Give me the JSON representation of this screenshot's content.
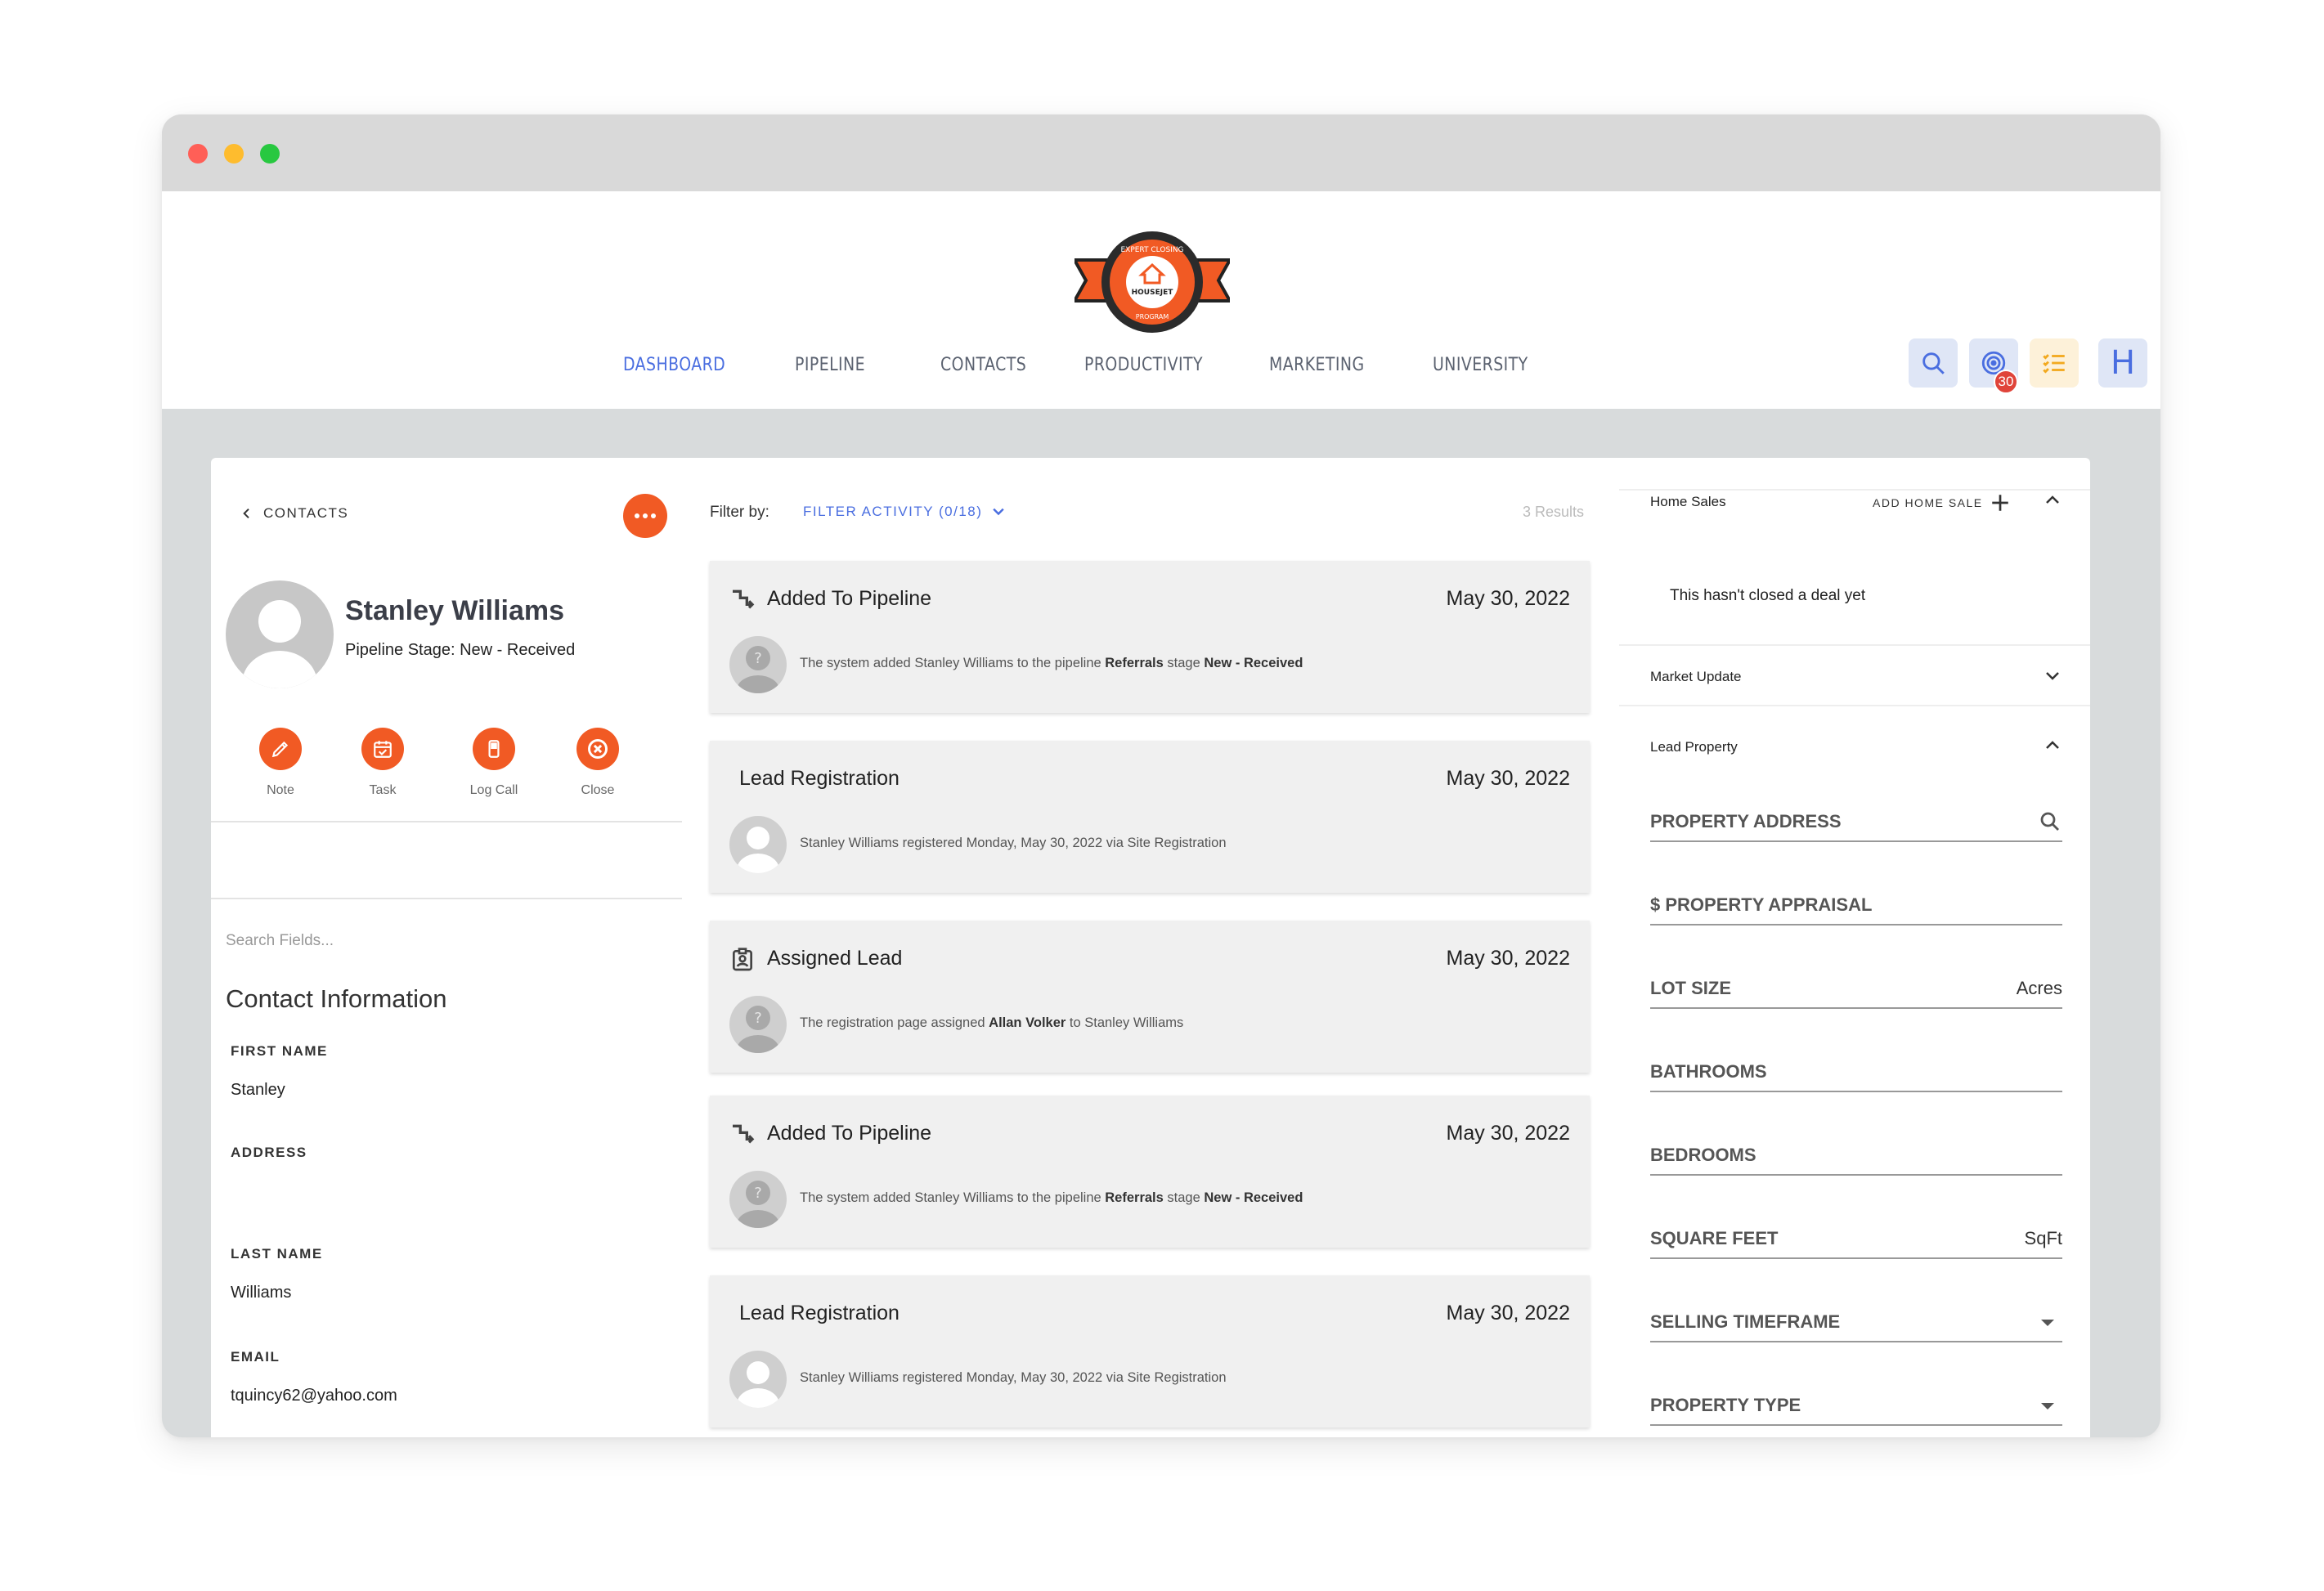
{
  "logo": {
    "text_top": "EXPERT CLOSING",
    "text_center": "HOUSEJET",
    "text_bottom": "PROGRAM"
  },
  "nav": {
    "items": [
      "DASHBOARD",
      "PIPELINE",
      "CONTACTS",
      "PRODUCTIVITY",
      "MARKETING",
      "UNIVERSITY"
    ],
    "active": "DASHBOARD"
  },
  "header_actions": {
    "notification_count": "30",
    "user_initial": "H"
  },
  "colors": {
    "accent": "#4a6ee0",
    "brand_orange": "#f15a24",
    "badge_red": "#e0443a"
  },
  "contact": {
    "back_label": "CONTACTS",
    "more_icon": "more-horizontal-icon",
    "name": "Stanley Williams",
    "pipeline_stage": "Pipeline Stage: New - Received",
    "actions": [
      {
        "label": "Note",
        "icon": "pen-icon"
      },
      {
        "label": "Task",
        "icon": "calendar-check-icon"
      },
      {
        "label": "Log Call",
        "icon": "phone-icon"
      },
      {
        "label": "Close",
        "icon": "close-circle-icon"
      }
    ],
    "search_placeholder": "Search Fields...",
    "section_title": "Contact Information",
    "fields": [
      {
        "label": "FIRST NAME",
        "value": "Stanley"
      },
      {
        "label": "ADDRESS",
        "value": ""
      },
      {
        "label": "LAST NAME",
        "value": "Williams"
      },
      {
        "label": "EMAIL",
        "value": "tquincy62@yahoo.com"
      }
    ]
  },
  "activity": {
    "filter_by_label": "Filter by:",
    "filter_button": "FILTER ACTIVITY (0/18)",
    "results": "3 Results",
    "cards": [
      {
        "title": "Added To Pipeline",
        "date": "May 30, 2022",
        "icon": "pipeline-icon",
        "desc_pre": "The system added Stanley Williams to the pipeline ",
        "desc_b1": "Referrals",
        "desc_mid": " stage ",
        "desc_b2": "New - Received",
        "desc_post": ""
      },
      {
        "title": "Lead Registration",
        "date": "May 30, 2022",
        "icon": "",
        "desc_pre": "Stanley Williams registered Monday, May 30, 2022 via Site Registration",
        "desc_b1": "",
        "desc_mid": "",
        "desc_b2": "",
        "desc_post": ""
      },
      {
        "title": "Assigned Lead",
        "date": "May 30, 2022",
        "icon": "assigned-icon",
        "desc_pre": "The registration page assigned ",
        "desc_b1": "Allan Volker",
        "desc_mid": " to Stanley Williams",
        "desc_b2": "",
        "desc_post": ""
      },
      {
        "title": "Added To Pipeline",
        "date": "May 30, 2022",
        "icon": "pipeline-icon",
        "desc_pre": "The system added Stanley Williams to the pipeline ",
        "desc_b1": "Referrals",
        "desc_mid": " stage ",
        "desc_b2": "New - Received",
        "desc_post": ""
      },
      {
        "title": "Lead Registration",
        "date": "May 30, 2022",
        "icon": "",
        "desc_pre": "Stanley Williams registered Monday, May 30, 2022 via Site Registration",
        "desc_b1": "",
        "desc_mid": "",
        "desc_b2": "",
        "desc_post": ""
      }
    ]
  },
  "sidebar": {
    "home_sales": {
      "title": "Home Sales",
      "add_label": "ADD HOME SALE",
      "empty": "This hasn't closed a deal yet"
    },
    "market_update": {
      "title": "Market Update"
    },
    "lead_property": {
      "title": "Lead Property",
      "fields": [
        {
          "label": "PROPERTY ADDRESS",
          "suffix": "",
          "kind": "search"
        },
        {
          "label": "$ PROPERTY APPRAISAL",
          "suffix": "",
          "kind": "text"
        },
        {
          "label": "LOT SIZE",
          "suffix": "Acres",
          "kind": "text"
        },
        {
          "label": "BATHROOMS",
          "suffix": "",
          "kind": "text"
        },
        {
          "label": "BEDROOMS",
          "suffix": "",
          "kind": "text"
        },
        {
          "label": "SQUARE FEET",
          "suffix": "SqFt",
          "kind": "text"
        },
        {
          "label": "SELLING TIMEFRAME",
          "suffix": "",
          "kind": "select"
        },
        {
          "label": "PROPERTY TYPE",
          "suffix": "",
          "kind": "select"
        }
      ]
    }
  }
}
